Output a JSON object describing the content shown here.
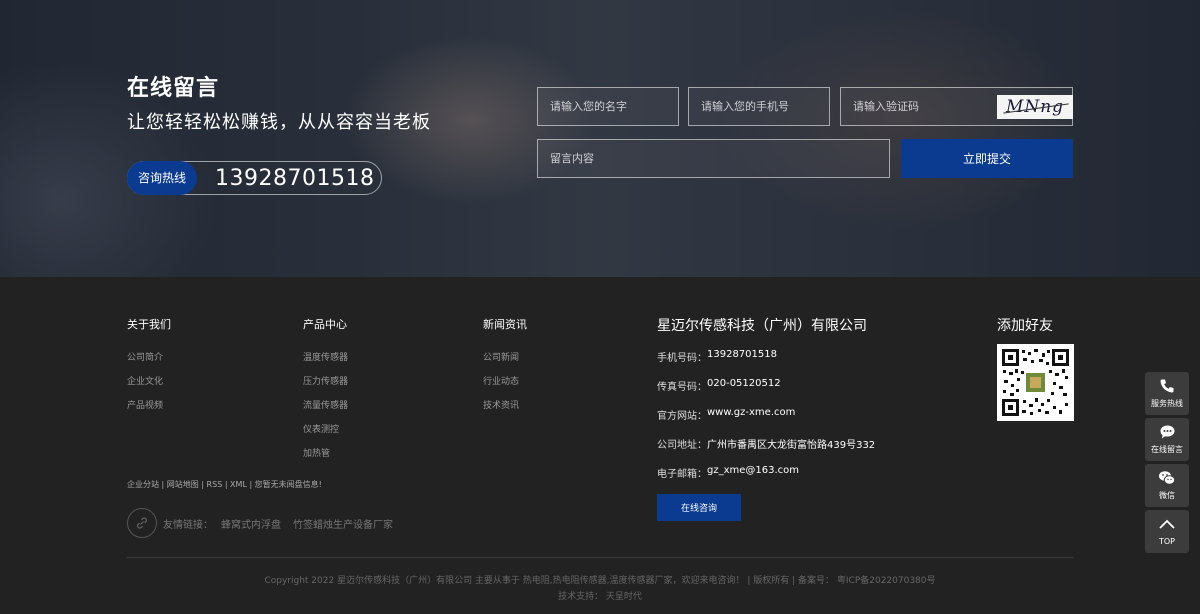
{
  "hero": {
    "title": "在线留言",
    "subtitle": "让您轻轻松松赚钱，从从容容当老板",
    "hotline_label": "咨询热线",
    "hotline_number": "13928701518"
  },
  "form": {
    "name_placeholder": "请输入您的名字",
    "phone_placeholder": "请输入您的手机号",
    "code_placeholder": "请输入验证码",
    "captcha_text": "MNng",
    "message_placeholder": "留言内容",
    "submit_label": "立即提交"
  },
  "footer": {
    "col1": {
      "title": "关于我们",
      "links": [
        "公司简介",
        "企业文化",
        "产品视频"
      ]
    },
    "col2": {
      "title": "产品中心",
      "links": [
        "温度传感器",
        "压力传感器",
        "流量传感器",
        "仪表测控",
        "加热管"
      ]
    },
    "col3": {
      "title": "新闻资讯",
      "links": [
        "公司新闻",
        "行业动态",
        "技术资讯"
      ]
    },
    "company": {
      "name": "星迈尔传感科技（广州）有限公司",
      "phone_label": "手机号码：",
      "phone": "13928701518",
      "fax_label": "传真号码：",
      "fax": "020-05120512",
      "site_label": "官方网站：",
      "site": "www.gz-xme.com",
      "address_label": "公司地址：",
      "address": "广州市番禺区大龙街富怡路439号332",
      "email_label": "电子邮箱：",
      "email": "gz_xme@163.com",
      "consult_button": "在线咨询"
    },
    "add_friend": "添加好友",
    "misc_links": "企业分站 | 网站地图 | RSS | XML | 您暂无未阅盘信息!",
    "friend_links_label": "友情链接：",
    "friend_links": [
      "蜂窝式内浮盘",
      "竹签蜡烛生产设备厂家"
    ],
    "copyright": "Copyright 2022 星迈尔传感科技（广州）有限公司 主要从事于 热电阻,热电阻传感器,温度传感器厂家，欢迎来电咨询！ | 版权所有 | 备案号： 粤ICP备2022070380号",
    "support": "技术支持： 天呈时代"
  },
  "sidebar": {
    "hotline": "服务热线",
    "message": "在线留言",
    "wechat": "微信",
    "top": "TOP"
  },
  "colors": {
    "accent": "#0b3a91",
    "footer_bg": "#222222",
    "sidebar_bg": "#3c3c3c"
  }
}
